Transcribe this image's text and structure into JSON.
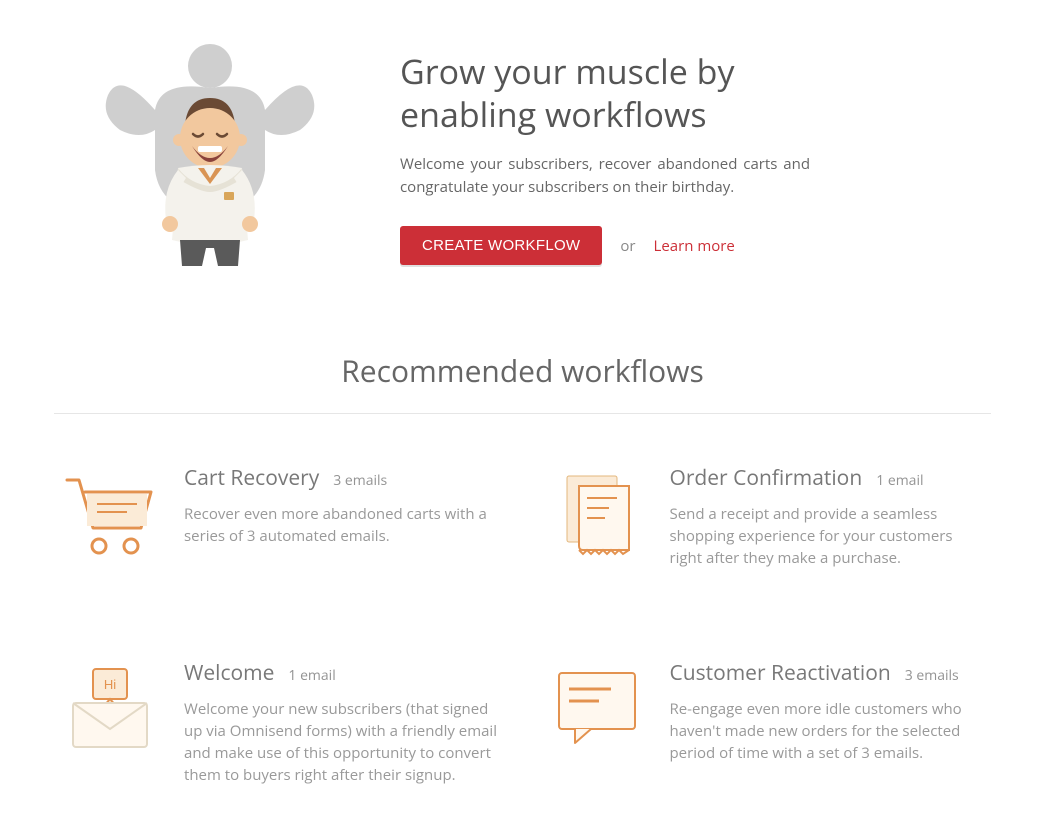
{
  "hero": {
    "title": "Grow your muscle by enabling workflows",
    "subtitle": "Welcome your subscribers, recover abandoned carts and congratulate your subscribers on their birthday.",
    "cta": "CREATE WORKFLOW",
    "or": "or",
    "learn": "Learn more"
  },
  "section_title": "Recommended workflows",
  "cards": [
    {
      "title": "Cart Recovery",
      "meta": "3 emails",
      "desc": "Recover even more abandoned carts with a series of 3 automated emails."
    },
    {
      "title": "Order Confirmation",
      "meta": "1 email",
      "desc": "Send a receipt and provide a seamless shopping experience for your customers right after they make a purchase."
    },
    {
      "title": "Welcome",
      "meta": "1 email",
      "desc": "Welcome your new subscribers (that signed up via Omnisend forms) with a friendly email and make use of this opportunity to convert them to buyers right after their signup."
    },
    {
      "title": "Customer Reactivation",
      "meta": "3 emails",
      "desc": "Re-engage even more idle customers who haven't made new orders for the selected period of time with a set of 3 emails."
    }
  ]
}
